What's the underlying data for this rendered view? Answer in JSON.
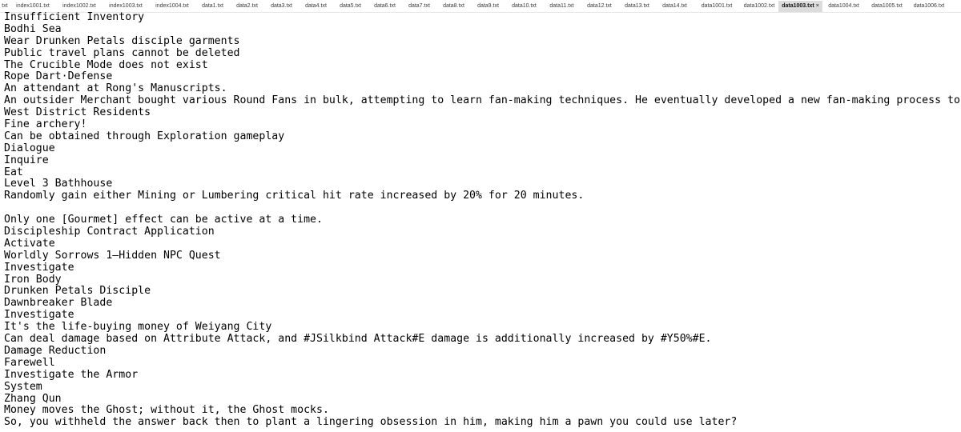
{
  "tabs": [
    {
      "label": "txt",
      "width": 12
    },
    {
      "label": "index1001.txt",
      "width": 58
    },
    {
      "label": "index1002.txt",
      "width": 58
    },
    {
      "label": "index1003.txt",
      "width": 58
    },
    {
      "label": "index1004.txt",
      "width": 58
    },
    {
      "label": "data1.txt",
      "width": 43
    },
    {
      "label": "data2.txt",
      "width": 43
    },
    {
      "label": "data3.txt",
      "width": 43
    },
    {
      "label": "data4.txt",
      "width": 43
    },
    {
      "label": "data5.txt",
      "width": 43
    },
    {
      "label": "data6.txt",
      "width": 43
    },
    {
      "label": "data7.txt",
      "width": 43
    },
    {
      "label": "data8.txt",
      "width": 43
    },
    {
      "label": "data9.txt",
      "width": 43
    },
    {
      "label": "data10.txt",
      "width": 47
    },
    {
      "label": "data11.txt",
      "width": 47
    },
    {
      "label": "data12.txt",
      "width": 47
    },
    {
      "label": "data13.txt",
      "width": 47
    },
    {
      "label": "data14.txt",
      "width": 47
    },
    {
      "label": "data1001.txt",
      "width": 58
    },
    {
      "label": "data1002.txt",
      "width": 48
    },
    {
      "label": "data1003.txt",
      "width": 55,
      "active": true,
      "close": "×"
    },
    {
      "label": "data1004.txt",
      "width": 53
    },
    {
      "label": "data1005.txt",
      "width": 55
    },
    {
      "label": "data1006.txt",
      "width": 50
    }
  ],
  "lines": [
    "Insufficient Inventory",
    "Bodhi Sea",
    "Wear Drunken Petals disciple garments",
    "Public travel plans cannot be deleted",
    "The Crucible Mode does not exist",
    "Rope Dart·Defense",
    "An attendant at Rong's Manuscripts.",
    "An outsider Merchant bought various Round Fans in bulk, attempting to learn fan-making techniques. He eventually developed a new fan-making process to compete",
    "West District Residents",
    "Fine archery!",
    "Can be obtained through Exploration gameplay",
    "Dialogue",
    "Inquire",
    "Eat",
    "Level 3 Bathhouse",
    "Randomly gain either Mining or Lumbering critical hit rate increased by 20% for 20 minutes.",
    "",
    "Only one [Gourmet] effect can be active at a time.",
    "Discipleship Contract Application",
    "Activate",
    "Worldly Sorrows 1—Hidden NPC Quest",
    "Investigate",
    "Iron Body",
    "Drunken Petals Disciple",
    "Dawnbreaker Blade",
    "Investigate",
    "It's the life-buying money of Weiyang City",
    "Can deal damage based on Attribute Attack, and #JSilkbind Attack#E damage is additionally increased by #Y50%#E.",
    "Damage Reduction",
    "Farewell",
    "Investigate the Armor",
    "System",
    "Zhang Qun",
    "Money moves the Ghost; without it, the Ghost mocks.",
    "So, you withheld the answer back then to plant a lingering obsession in him, making him a pawn you could use later?"
  ]
}
